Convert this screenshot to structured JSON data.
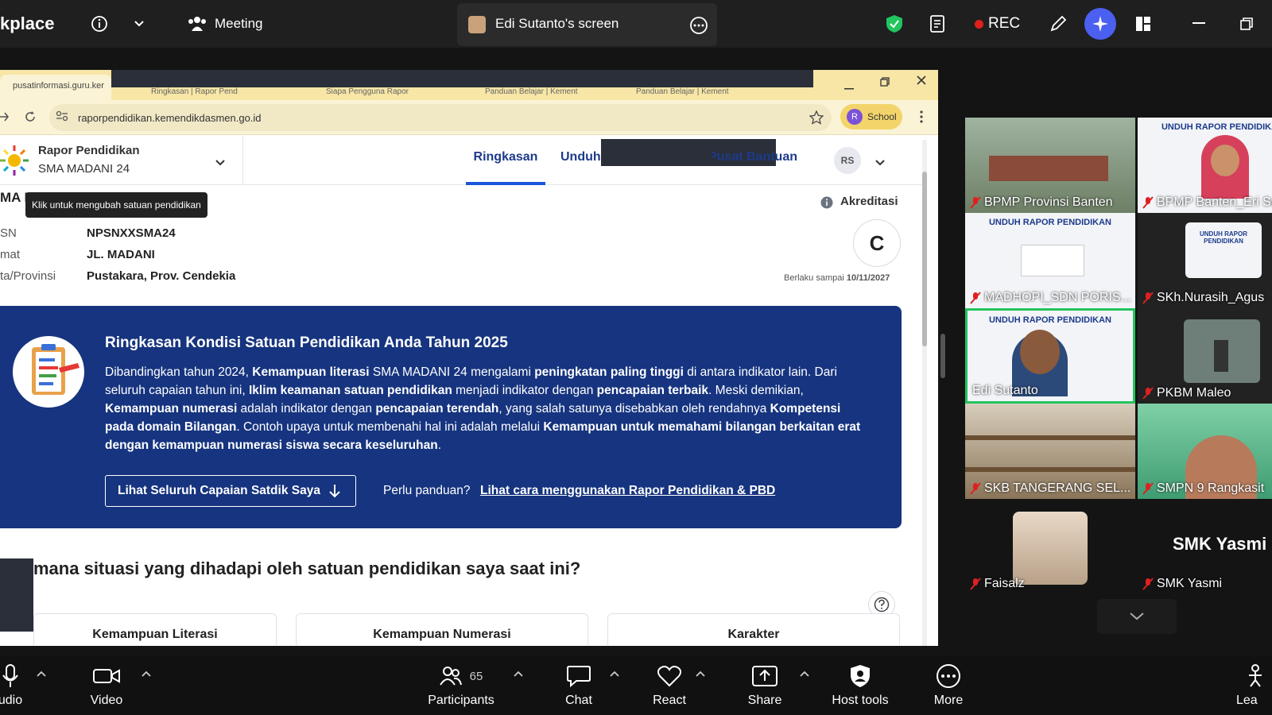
{
  "topbar": {
    "app_name": "kplace",
    "meeting_label": "Meeting",
    "share_label": "Edi Sutanto's screen",
    "rec_label": "REC"
  },
  "browser": {
    "tabs": [
      "pusatinformasi.guru.ker",
      "Ringkasan | Rapor Pend",
      "Siapa Pengguna Rapor",
      "Panduan Belajar | Kement",
      "Panduan Belajar | Kement"
    ],
    "url": "raporpendidikan.kemendikdasmen.go.id",
    "profile_label": "School",
    "profile_initial": "R"
  },
  "site": {
    "brand": "Rapor Pendidikan",
    "school": "SMA MADANI 24",
    "tooltip": "Klik untuk mengubah satuan pendidikan",
    "nav": [
      "Ringkasan",
      "Unduh",
      "Pusat Bantuan"
    ],
    "avatar": "RS"
  },
  "school_info": {
    "name_partial": "MA M",
    "rows": [
      {
        "label": "SN",
        "value": "NPSNXXSMA24"
      },
      {
        "label": "mat",
        "value": "JL. MADANI"
      },
      {
        "label": "ta/Provinsi",
        "value": "Pustakara, Prov. Cendekia"
      }
    ],
    "accreditation_label": "Akreditasi",
    "grade": "C",
    "valid_label": "Berlaku sampai",
    "valid_date": "10/11/2027"
  },
  "banner": {
    "title": "Ringkasan Kondisi Satuan Pendidikan Anda Tahun 2025",
    "p1a": "Dibandingkan tahun 2024, ",
    "p1b": "Kemampuan literasi",
    "p1c": " SMA MADANI 24 mengalami ",
    "p1d": "peningkatan paling tinggi",
    "p1e": " di antara indikator lain. Dari seluruh capaian tahun ini, ",
    "p1f": "Iklim keamanan satuan pendidikan",
    "p1g": " menjadi indikator dengan ",
    "p1h": "pencapaian terbaik",
    "p1i": ". Meski demikian, ",
    "p1j": "Kemampuan numerasi",
    "p1k": " adalah indikator dengan ",
    "p1l": "pencapaian terendah",
    "p1m": ", yang salah satunya disebabkan oleh rendahnya ",
    "p1n": "Kompetensi pada domain Bilangan",
    "p1o": ". Contoh upaya untuk membenahi hal ini adalah melalui ",
    "p1p": "Kemampuan untuk memahami bilangan berkaitan erat dengan kemampuan numerasi siswa secara keseluruhan",
    "p1q": ".",
    "button": "Lihat Seluruh Capaian Satdik Saya",
    "help_q": "Perlu panduan?",
    "help_link": "Lihat cara menggunakan Rapor Pendidikan & PBD"
  },
  "section": {
    "title": "mana situasi yang dihadapi oleh satuan pendidikan saya saat ini?",
    "cards": [
      "Kemampuan Literasi",
      "Kemampuan Numerasi",
      "Karakter"
    ]
  },
  "participants": [
    {
      "name": "BPMP Provinsi Banten"
    },
    {
      "name": "BPMP Banten_Eri Susa"
    },
    {
      "name": "MADHOPI_SDN PORIS..."
    },
    {
      "name": "SKh.Nurasih_Agus"
    },
    {
      "name": "Edi Sutanto"
    },
    {
      "name": "PKBM Maleo"
    },
    {
      "name": "SKB TANGERANG SEL..."
    },
    {
      "name": "SMPN 9 Rangkasit"
    },
    {
      "name": "Faisalz"
    },
    {
      "name": "SMK Yasmi"
    }
  ],
  "slide_heading": "UNDUH RAPOR PENDIDIKAN",
  "big_name": "SMK Yasmi",
  "toolbar": {
    "audio": "udio",
    "video": "Video",
    "participants": "Participants",
    "participants_count": "65",
    "chat": "Chat",
    "react": "React",
    "share": "Share",
    "host_tools": "Host tools",
    "more": "More",
    "leave": "Lea"
  },
  "colors": {
    "banner": "#16347f",
    "accent": "#1a56db",
    "rec": "#e02020",
    "active_speaker": "#22c55e"
  }
}
